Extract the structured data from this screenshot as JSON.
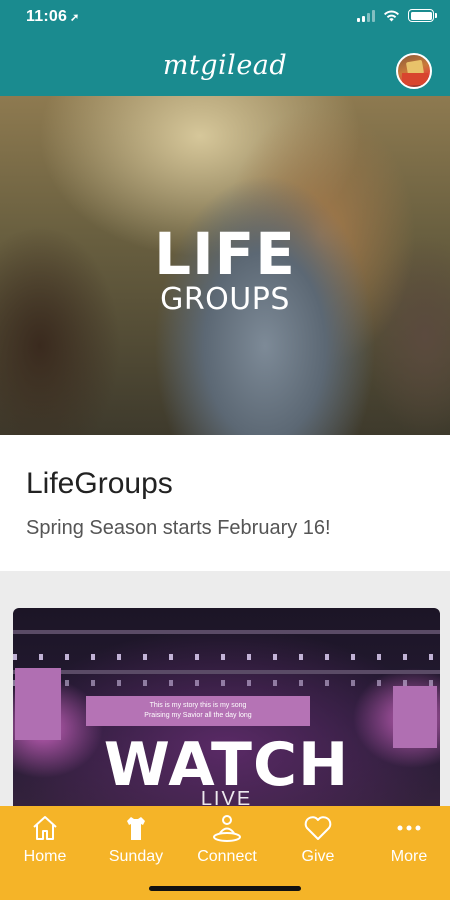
{
  "status": {
    "time": "11:06",
    "location_arrow": "➚"
  },
  "header": {
    "brand": "mtgilead",
    "avatar": "profile-avatar"
  },
  "hero": {
    "title_big": "LIFE",
    "title_small": "GROUPS"
  },
  "card": {
    "title": "LifeGroups",
    "subtitle": "Spring Season starts February 16!"
  },
  "watch": {
    "screen_line1": "This is my story this is my song",
    "screen_line2": "Praising my Savior all the day long",
    "title": "WATCH",
    "subtitle": "LIVE"
  },
  "tabs": [
    {
      "label": "Home",
      "icon": "home-icon"
    },
    {
      "label": "Sunday",
      "icon": "shirt-icon"
    },
    {
      "label": "Connect",
      "icon": "people-icon"
    },
    {
      "label": "Give",
      "icon": "heart-icon"
    },
    {
      "label": "More",
      "icon": "more-icon"
    }
  ],
  "colors": {
    "header": "#1a8b8f",
    "tabbar": "#f5b428"
  }
}
